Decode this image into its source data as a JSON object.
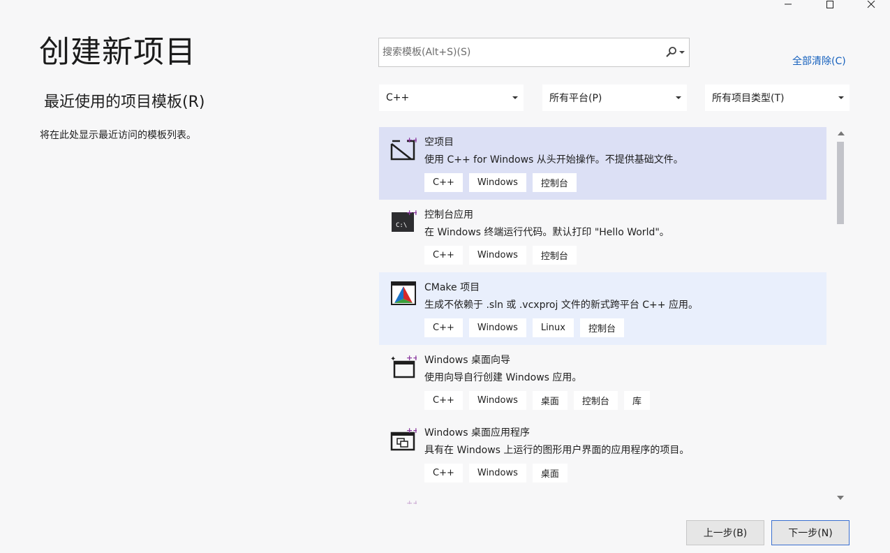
{
  "window": {
    "minimize_glyph": "—",
    "maximize_glyph": "☐",
    "close_glyph": "✕"
  },
  "header": {
    "title": "创建新项目"
  },
  "recent": {
    "heading": "最近使用的项目模板(R)",
    "empty_text": "将在此处显示最近访问的模板列表。"
  },
  "search": {
    "placeholder": "搜索模板(Alt+S)(S)",
    "value": ""
  },
  "clear_all": "全部清除(C)",
  "filters": {
    "language": "C++",
    "platform": "所有平台(P)",
    "project_type": "所有项目类型(T)"
  },
  "templates": [
    {
      "name": "空项目",
      "description": "使用 C++ for Windows 从头开始操作。不提供基础文件。",
      "tags": [
        "C++",
        "Windows",
        "控制台"
      ],
      "icon": "empty-project-icon",
      "state": "selected"
    },
    {
      "name": "控制台应用",
      "description": "在 Windows 终端运行代码。默认打印 \"Hello World\"。",
      "tags": [
        "C++",
        "Windows",
        "控制台"
      ],
      "icon": "console-app-icon",
      "state": "normal"
    },
    {
      "name": "CMake 项目",
      "description": "生成不依赖于 .sln 或 .vcxproj 文件的新式跨平台 C++ 应用。",
      "tags": [
        "C++",
        "Windows",
        "Linux",
        "控制台"
      ],
      "icon": "cmake-icon",
      "state": "hover"
    },
    {
      "name": "Windows 桌面向导",
      "description": "使用向导自行创建 Windows 应用。",
      "tags": [
        "C++",
        "Windows",
        "桌面",
        "控制台",
        "库"
      ],
      "icon": "desktop-wizard-icon",
      "state": "normal"
    },
    {
      "name": "Windows 桌面应用程序",
      "description": "具有在 Windows 上运行的图形用户界面的应用程序的项目。",
      "tags": [
        "C++",
        "Windows",
        "桌面"
      ],
      "icon": "desktop-app-icon",
      "state": "normal"
    }
  ],
  "buttons": {
    "back": "上一步(B)",
    "next": "下一步(N)"
  },
  "colors": {
    "accent": "#1560bd",
    "selected_bg": "#dce0f5",
    "hover_bg": "#e9effc",
    "plus_badge": "#8b3a9f"
  }
}
